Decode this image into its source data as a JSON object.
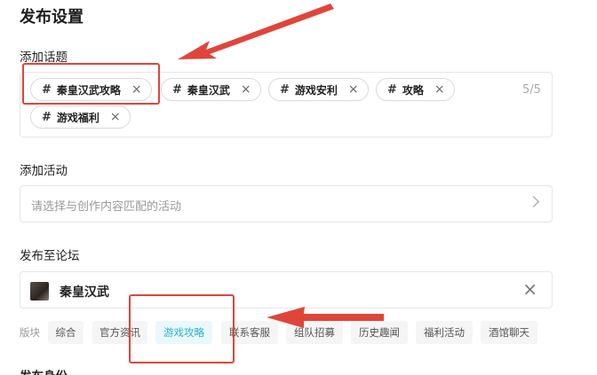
{
  "title": "发布设置",
  "topics": {
    "label": "添加话题",
    "counter": "5/5",
    "hash_symbol": "#",
    "remove_symbol": "×",
    "tags": [
      "秦皇汉武攻略",
      "秦皇汉武",
      "游戏安利",
      "攻略",
      "游戏福利"
    ]
  },
  "activity": {
    "label": "添加活动",
    "placeholder": "请选择与创作内容匹配的活动"
  },
  "forum": {
    "label": "发布至论坛",
    "selected_name": "秦皇汉武",
    "close_symbol": "×",
    "board_label": "版块",
    "boards": [
      "综合",
      "官方资讯",
      "游戏攻略",
      "联系客服",
      "组队招募",
      "历史趣闻",
      "福利活动",
      "酒馆聊天"
    ],
    "active_board": "游戏攻略"
  },
  "next_section_label": "发布身份",
  "colors": {
    "accent": "#2bb3c6",
    "annotation": "#e0453a"
  }
}
